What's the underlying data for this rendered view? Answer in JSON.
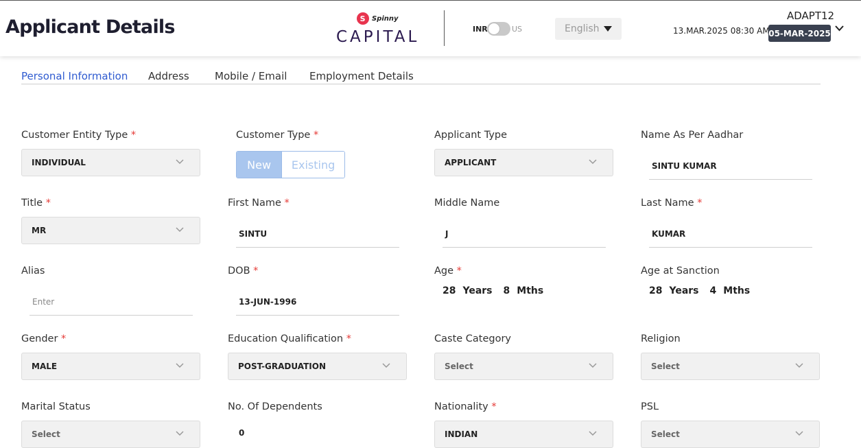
{
  "header": {
    "title": "Applicant Details",
    "logo": {
      "brand_small": "Spinny",
      "brand_large": "CAPITAL",
      "badge_letter": "S"
    },
    "currency": {
      "left": "INR",
      "right": "US"
    },
    "language": "English",
    "datetime": "13.MAR.2025 08:30 AM",
    "user_id": "ADAPT12",
    "business_date": "05-MAR-2025"
  },
  "tabs": [
    {
      "label": "Personal Information",
      "active": true
    },
    {
      "label": "Address",
      "active": false
    },
    {
      "label": "Mobile / Email",
      "active": false
    },
    {
      "label": "Employment Details",
      "active": false
    }
  ],
  "form": {
    "customer_entity_type": {
      "label": "Customer Entity Type",
      "value": "INDIVIDUAL",
      "required": "*"
    },
    "customer_type": {
      "label": "Customer Type",
      "required": "*",
      "options": [
        "New",
        "Existing"
      ],
      "selected": "New"
    },
    "applicant_type": {
      "label": "Applicant Type",
      "value": "APPLICANT"
    },
    "name_as_per_aadhar": {
      "label": "Name As Per Aadhar",
      "value": "SINTU KUMAR"
    },
    "title": {
      "label": "Title",
      "value": "MR",
      "required": "*"
    },
    "first_name": {
      "label": "First Name",
      "value": "SINTU",
      "required": "*"
    },
    "middle_name": {
      "label": "Middle Name",
      "value": "J"
    },
    "last_name": {
      "label": "Last Name",
      "value": "KUMAR",
      "required": "*"
    },
    "alias": {
      "label": "Alias",
      "placeholder": "Enter"
    },
    "dob": {
      "label": "DOB",
      "value": "13-JUN-1996",
      "required": "*"
    },
    "age": {
      "label": "Age",
      "required": "*",
      "years": "28",
      "years_unit": "Years",
      "months": "8",
      "months_unit": "Mths"
    },
    "age_at_sanction": {
      "label": "Age at Sanction",
      "years": "28",
      "years_unit": "Years",
      "months": "4",
      "months_unit": "Mths"
    },
    "gender": {
      "label": "Gender",
      "value": "MALE",
      "required": "*"
    },
    "education": {
      "label": "Education Qualification",
      "value": "POST-GRADUATION",
      "required": "*"
    },
    "caste_category": {
      "label": "Caste Category",
      "value": "Select"
    },
    "religion": {
      "label": "Religion",
      "value": "Select"
    },
    "marital_status": {
      "label": "Marital Status",
      "value": "Select"
    },
    "dependents": {
      "label": "No. Of Dependents",
      "value": "0"
    },
    "nationality": {
      "label": "Nationality",
      "value": "INDIAN",
      "required": "*"
    },
    "psl": {
      "label": "PSL",
      "value": "Select"
    }
  },
  "colors": {
    "accent": "#2f5bd0",
    "required": "#e53935",
    "badge_bg": "#3a4150",
    "logo_red": "#e8344e",
    "logo_purple": "#2b1a4f"
  }
}
